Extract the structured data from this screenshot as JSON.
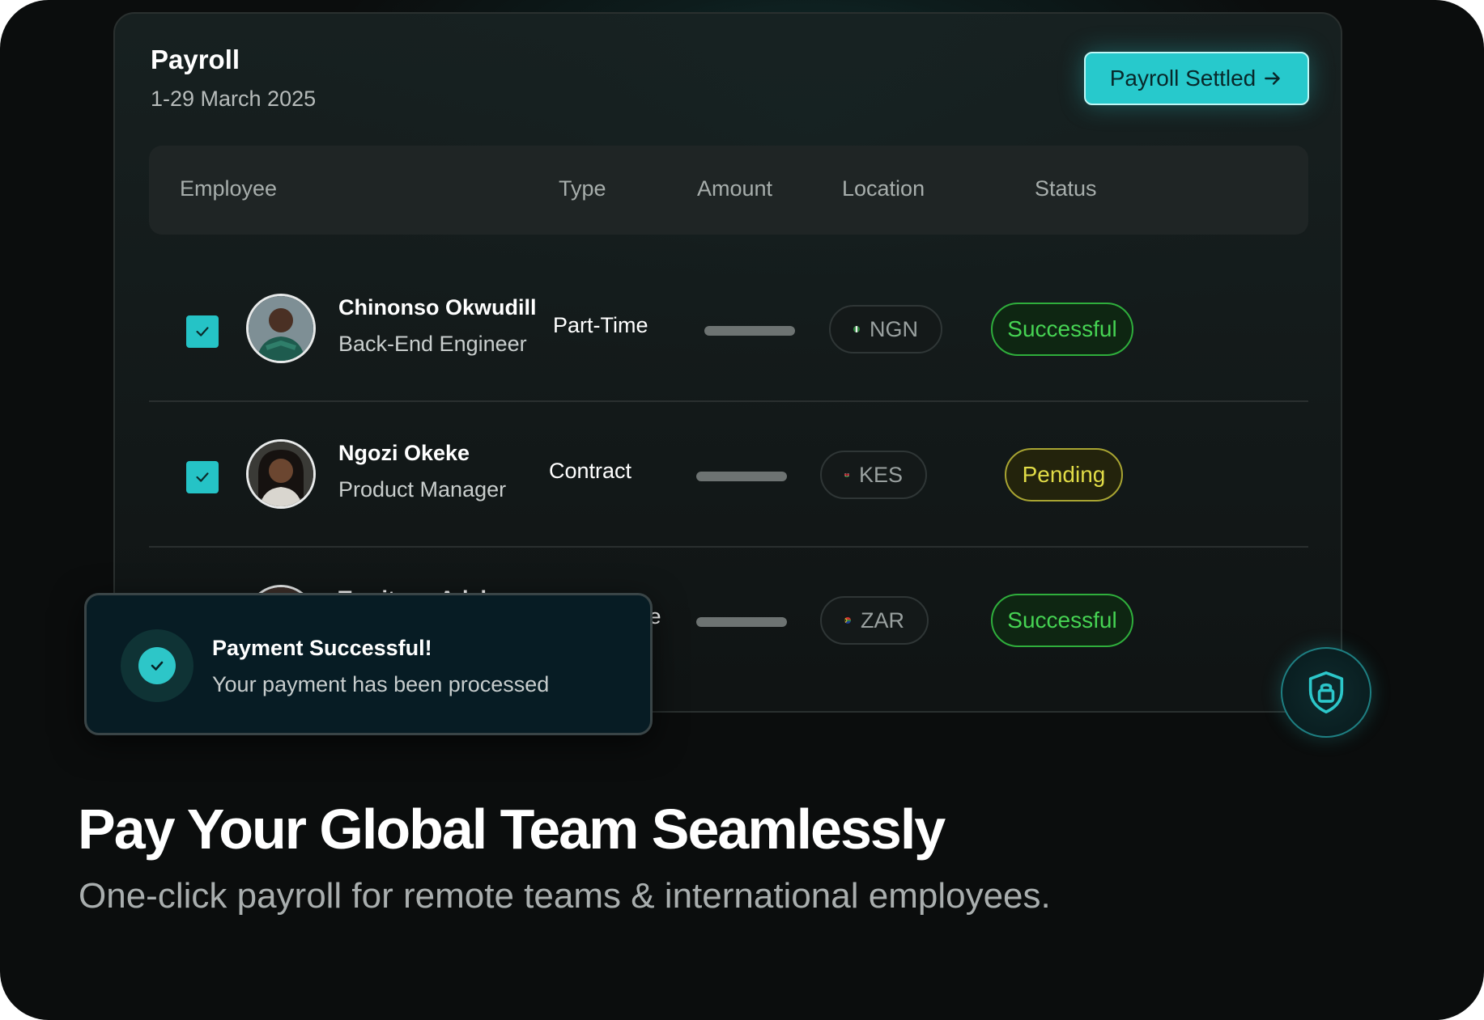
{
  "card": {
    "title": "Payroll",
    "period": "1-29 March 2025",
    "settle_button": "Payroll Settled",
    "settle_icon": "arrow-right-icon"
  },
  "table": {
    "headers": [
      "Employee",
      "Type",
      "Amount",
      "Location",
      "Status"
    ],
    "rows": [
      {
        "name": "Chinonso Okwudill",
        "role": "Back-End Engineer",
        "type": "Part-Time",
        "location": "NGN",
        "status": "Successful",
        "status_color": "#46d353"
      },
      {
        "name": "Ngozi Okeke",
        "role": "Product Manager",
        "type": "Contract",
        "location": "KES",
        "status": "Pending",
        "status_color": "#e1dc47"
      },
      {
        "name": "Temitope Adebayo",
        "role": "",
        "type": "Part-Time",
        "location": "ZAR",
        "status": "Successful",
        "status_color": "#46d353"
      }
    ]
  },
  "toast": {
    "title": "Payment Successful!",
    "message": "Your payment has been processed",
    "icon": "check-circle-icon"
  },
  "lock_button": {
    "icon": "shield-lock-icon"
  },
  "hero": {
    "headline": "Pay Your Global Team Seamlessly",
    "subheadline": "One-click payroll for remote teams & international employees."
  },
  "colors": {
    "accent": "#27c9cc",
    "success": "#46d353",
    "pending": "#e1dc47",
    "background": "#0b0c0c"
  }
}
